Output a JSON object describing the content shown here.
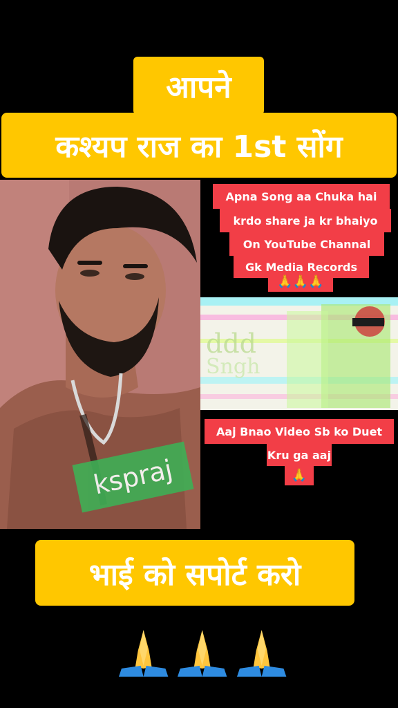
{
  "overlay": {
    "title_line1": "आपने",
    "title_line2": "कश्यप राज का 1st सोंग",
    "red_boxes": [
      "Apna Song aa Chuka hai",
      "krdo share ja kr bhaiyo",
      "On YouTube Channal",
      "Gk Media Records"
    ],
    "duet_lines": [
      "Aaj Bnao Video Sb ko Duet",
      "Kru ga aaj"
    ],
    "watermark": "kspraj",
    "bottom_banner": "भाई को सपोर्ट करो",
    "small_pray": "🙏🙏🙏",
    "small_pray_single": "🙏"
  },
  "colors": {
    "yellow": "#FFC700",
    "red": "#F23E47",
    "green_badge": "#3FAF55"
  },
  "icons": [
    "folded-hands-icon"
  ]
}
